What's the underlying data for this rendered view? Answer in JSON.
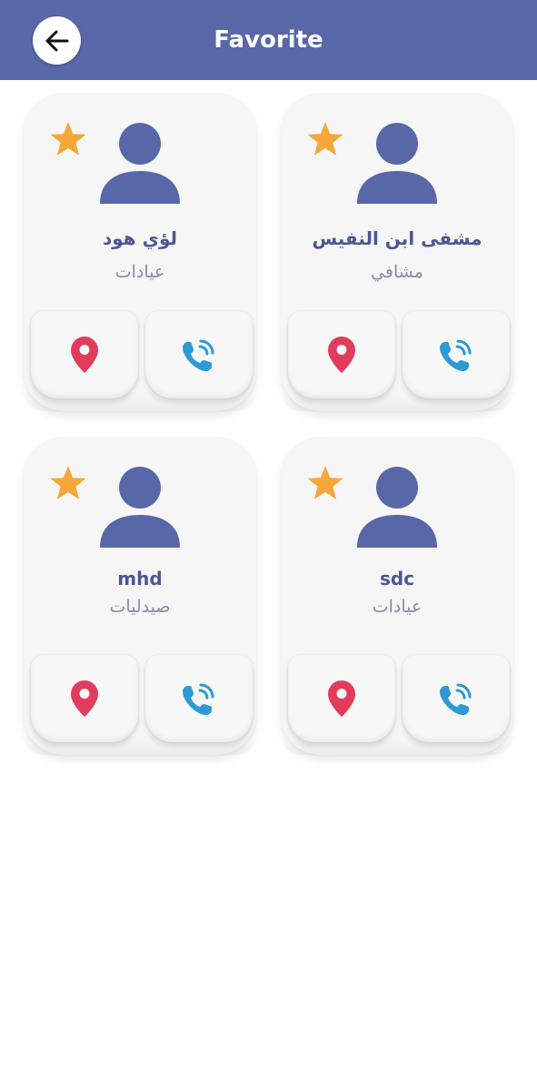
{
  "header": {
    "title": "Favorite",
    "background": "#5867a8",
    "back_icon": "arrow-left-icon"
  },
  "colors": {
    "star": "#f5a838",
    "avatar": "#5867a8",
    "location": "#e23b5c",
    "call": "#2d9ad6"
  },
  "favorites": [
    {
      "name": "لؤي هود",
      "category": "عيادات"
    },
    {
      "name": "مشفى ابن النفيس",
      "category": "مشافي"
    },
    {
      "name": "mhd",
      "category": "صيدليات"
    },
    {
      "name": "sdc",
      "category": "عيادات"
    }
  ]
}
